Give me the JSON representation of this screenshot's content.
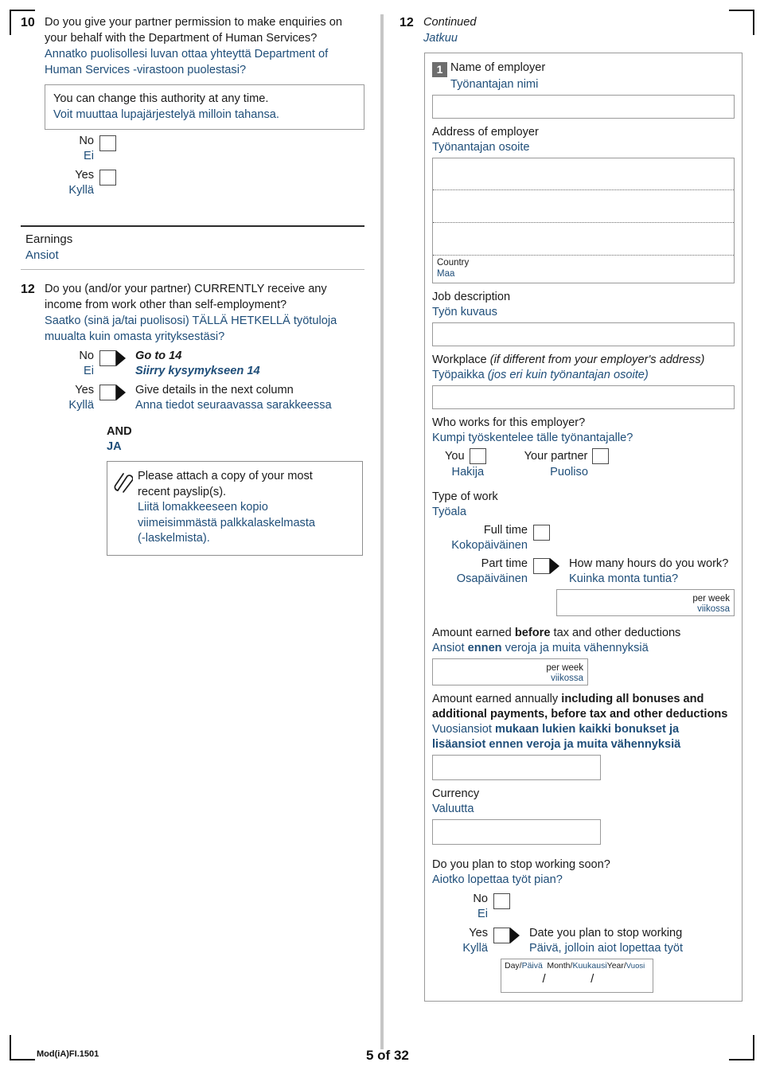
{
  "document": {
    "footer_code": "Mod(iA)FI.1501",
    "page_label": "5 of 32"
  },
  "left_column": {
    "q10": {
      "number": "10",
      "en_line1": "Do you give your partner permission to make enquiries on",
      "en_line2": "your behalf with the Department of Human Services?",
      "fi_line1": "Annatko puolisollesi luvan ottaa yhteyttä Department of",
      "fi_line2": "Human Services -virastoon puolestasi?",
      "note_en": "You can change this authority at any time.",
      "note_fi": "Voit muuttaa lupajärjestelyä milloin tahansa.",
      "option_no_en": "No",
      "option_no_fi": "Ei",
      "option_yes_en": "Yes",
      "option_yes_fi": "Kyllä"
    },
    "earnings_section": {
      "title_en": "Earnings",
      "title_fi": "Ansiot"
    },
    "q12": {
      "number": "12",
      "en_line1": "Do you (and/or your partner) CURRENTLY receive any",
      "en_line2": "income from work other than self-employment?",
      "fi_line1": "Saatko (sinä ja/tai puolisosi) TÄLLÄ HETKELLÄ työtuloja",
      "fi_line2": "muualta kuin omasta yrityksestäsi?",
      "option_no_en": "No",
      "option_no_fi": "Ei",
      "no_action_en": "Go to 14",
      "no_action_fi": "Siirry kysymykseen 14",
      "option_yes_en": "Yes",
      "option_yes_fi": "Kyllä",
      "yes_action_en": "Give details in the next column",
      "yes_action_fi": "Anna tiedot seuraavassa sarakkeessa",
      "and_en": "AND",
      "and_fi": "JA",
      "attach_en_line1": "Please attach a copy of your most",
      "attach_en_line2": "recent payslip(s).",
      "attach_fi_line1": "Liitä lomakkeeseen kopio",
      "attach_fi_line2": "viimeisimmästä palkkalaskelmasta",
      "attach_fi_line3": "(-laskelmista)."
    }
  },
  "right_column": {
    "header": {
      "number": "12",
      "en": "Continued",
      "fi": "Jatkuu"
    },
    "employer": {
      "badge": "1",
      "name_en": "Name of employer",
      "name_fi": "Työnantajan nimi",
      "address_en": "Address of employer",
      "address_fi": "Työnantajan osoite",
      "country_en": "Country",
      "country_fi": "Maa"
    },
    "job": {
      "desc_en": "Job description",
      "desc_fi": "Työn kuvaus",
      "workplace_en_main": "Workplace ",
      "workplace_en_note": "(if different from your employer's address)",
      "workplace_fi_main": "Työpaikka ",
      "workplace_fi_note": "(jos eri kuin työnantajan osoite)"
    },
    "who_works": {
      "question_en": "Who works for this employer?",
      "question_fi": "Kumpi työskentelee tälle työnantajalle?",
      "you_en": "You",
      "you_fi": "Hakija",
      "partner_en": "Your partner",
      "partner_fi": "Puoliso"
    },
    "type_of_work": {
      "label_en": "Type of work",
      "label_fi": "Työala",
      "full_en": "Full time",
      "full_fi": "Kokopäiväinen",
      "part_en": "Part time",
      "part_fi": "Osapäiväinen",
      "hours_q_en": "How many hours do you work?",
      "hours_q_fi": "Kuinka monta tuntia?",
      "unit_en": "per week",
      "unit_fi": "viikossa"
    },
    "amount_before": {
      "text_en_a": "Amount earned ",
      "text_en_b": "before",
      "text_en_c": " tax and other deductions",
      "text_fi_a": "Ansiot ",
      "text_fi_b": "ennen",
      "text_fi_c": " veroja ja muita vähennyksiä",
      "unit_en": "per week",
      "unit_fi": "viikossa"
    },
    "amount_annual": {
      "text_en_a": "Amount earned annually ",
      "text_en_b": "including all bonuses and",
      "text_en_c": "additional payments, before tax and other deductions",
      "text_fi_a": "Vuosiansiot ",
      "text_fi_b": "mukaan lukien kaikki bonukset ja",
      "text_fi_c": "lisäansiot ennen veroja ja muita vähennyksiä",
      "currency_en": "Currency",
      "currency_fi": "Valuutta"
    },
    "stop_working": {
      "question_en": "Do you plan to stop working soon?",
      "question_fi": "Aiotko lopettaa työt pian?",
      "option_no_en": "No",
      "option_no_fi": "Ei",
      "option_yes_en": "Yes",
      "option_yes_fi": "Kyllä",
      "date_label_en": "Date you plan to stop working",
      "date_label_fi": "Päivä, jolloin aiot lopettaa työt",
      "date_day_en": "Day/",
      "date_day_fi": "Päivä",
      "date_month_en": "Month/",
      "date_month_fi": "Kuukausi",
      "date_year_en": "Year/",
      "date_year_fi": "Vuosi",
      "slash": "/"
    }
  },
  "colors": {
    "finnish_text": "#1F4E79",
    "english_text": "#1a1a1a",
    "badge_bg": "#6e6e6e",
    "box_border": "#9a9a9a",
    "divider": "#c6c6c6"
  }
}
